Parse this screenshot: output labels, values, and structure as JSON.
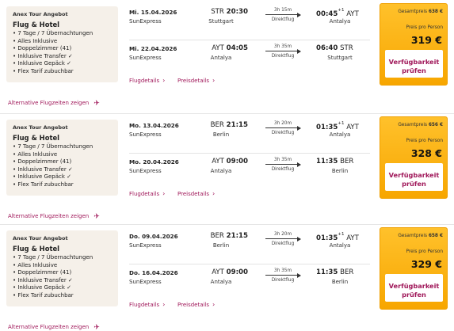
{
  "offers": [
    {
      "package": {
        "label": "Anex Tour Angebot",
        "title": "Flug & Hotel",
        "features": [
          "7 Tage / 7 Übernachtungen",
          "Alles Inklusive",
          "Doppelzimmer (41)",
          "Inklusive Transfer ✓",
          "Inklusive Gepäck ✓",
          "Flex Tarif zubuchbar"
        ]
      },
      "outbound": {
        "date": "Mi. 15.04.2026",
        "airline": "SunExpress",
        "dep_code": "STR",
        "dep_time": "20:30",
        "dep_city": "Stuttgart",
        "duration": "3h 15m",
        "direct": "Direktflug",
        "arr_time": "00:45",
        "arr_day": "+1",
        "arr_code": "AYT",
        "arr_city": "Antalya"
      },
      "return": {
        "date": "Mi. 22.04.2026",
        "airline": "SunExpress",
        "dep_code": "AYT",
        "dep_time": "04:05",
        "dep_city": "Antalya",
        "duration": "3h 35m",
        "direct": "Direktflug",
        "arr_time": "06:40",
        "arr_day": "",
        "arr_code": "STR",
        "arr_city": "Stuttgart"
      },
      "links": {
        "flight_details": "Flugdetails",
        "price_details": "Preisdetails",
        "alternative": "Alternative Flugzeiten zeigen"
      },
      "price": {
        "total_label": "Gesamtpreis",
        "total": "638 €",
        "per_person_label": "Preis pro Person",
        "per_person": "319 €",
        "button": [
          "Verfügbarkeit",
          "prüfen"
        ]
      }
    },
    {
      "package": {
        "label": "Anex Tour Angebot",
        "title": "Flug & Hotel",
        "features": [
          "7 Tage / 7 Übernachtungen",
          "Alles Inklusive",
          "Doppelzimmer (41)",
          "Inklusive Transfer ✓",
          "Inklusive Gepäck ✓",
          "Flex Tarif zubuchbar"
        ]
      },
      "outbound": {
        "date": "Mo. 13.04.2026",
        "airline": "SunExpress",
        "dep_code": "BER",
        "dep_time": "21:15",
        "dep_city": "Berlin",
        "duration": "3h 20m",
        "direct": "Direktflug",
        "arr_time": "01:35",
        "arr_day": "+1",
        "arr_code": "AYT",
        "arr_city": "Antalya"
      },
      "return": {
        "date": "Mo. 20.04.2026",
        "airline": "SunExpress",
        "dep_code": "AYT",
        "dep_time": "09:00",
        "dep_city": "Antalya",
        "duration": "3h 35m",
        "direct": "Direktflug",
        "arr_time": "11:35",
        "arr_day": "",
        "arr_code": "BER",
        "arr_city": "Berlin"
      },
      "links": {
        "flight_details": "Flugdetails",
        "price_details": "Preisdetails",
        "alternative": "Alternative Flugzeiten zeigen"
      },
      "price": {
        "total_label": "Gesamtpreis",
        "total": "656 €",
        "per_person_label": "Preis pro Person",
        "per_person": "328 €",
        "button": [
          "Verfügbarkeit",
          "prüfen"
        ]
      }
    },
    {
      "package": {
        "label": "Anex Tour Angebot",
        "title": "Flug & Hotel",
        "features": [
          "7 Tage / 7 Übernachtungen",
          "Alles Inklusive",
          "Doppelzimmer (41)",
          "Inklusive Transfer ✓",
          "Inklusive Gepäck ✓",
          "Flex Tarif zubuchbar"
        ]
      },
      "outbound": {
        "date": "Do. 09.04.2026",
        "airline": "SunExpress",
        "dep_code": "BER",
        "dep_time": "21:15",
        "dep_city": "Berlin",
        "duration": "3h 20m",
        "direct": "Direktflug",
        "arr_time": "01:35",
        "arr_day": "+1",
        "arr_code": "AYT",
        "arr_city": "Antalya"
      },
      "return": {
        "date": "Do. 16.04.2026",
        "airline": "SunExpress",
        "dep_code": "AYT",
        "dep_time": "09:00",
        "dep_city": "Antalya",
        "duration": "3h 35m",
        "direct": "Direktflug",
        "arr_time": "11:35",
        "arr_day": "",
        "arr_code": "BER",
        "arr_city": "Berlin"
      },
      "links": {
        "flight_details": "Flugdetails",
        "price_details": "Preisdetails",
        "alternative": "Alternative Flugzeiten zeigen"
      },
      "price": {
        "total_label": "Gesamtpreis",
        "total": "658 €",
        "per_person_label": "Preis pro Person",
        "per_person": "329 €",
        "button": [
          "Verfügbarkeit",
          "prüfen"
        ]
      }
    }
  ],
  "icons": {
    "chevron": "chevron-right-icon",
    "plane": "plane-icon"
  },
  "colors": {
    "accent": "#a0185a",
    "price_bg": "#f7a600",
    "package_bg": "#f5f0e9"
  }
}
